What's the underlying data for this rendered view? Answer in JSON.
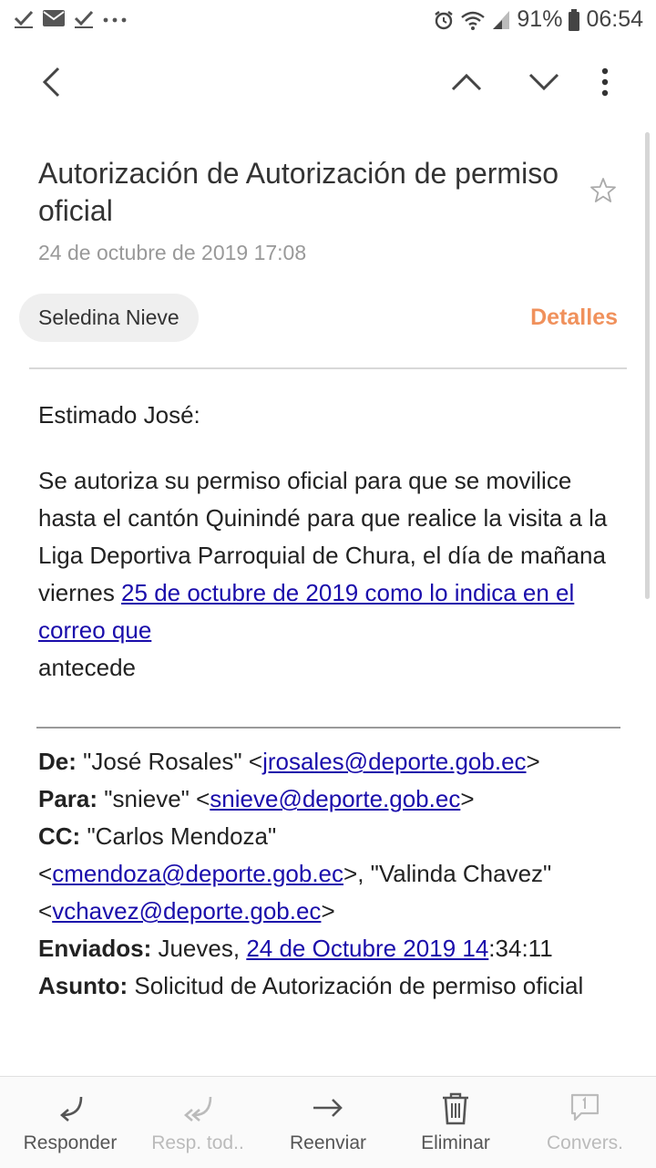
{
  "status_bar": {
    "battery": "91%",
    "time": "06:54",
    "icons": [
      "check-icon",
      "mail-icon",
      "check-icon",
      "more-icon",
      "alarm-icon",
      "wifi-icon",
      "signal-icon",
      "battery-icon"
    ]
  },
  "toolbar": {
    "back_icon": "chevron-left-icon",
    "prev_icon": "chevron-up-icon",
    "next_icon": "chevron-down-icon",
    "menu_icon": "more-vertical-icon"
  },
  "email": {
    "subject": "Autorización de Autorización de permiso oficial",
    "date": "24 de octubre de 2019  17:08",
    "sender": "Seledina Nieve",
    "details_label": "Detalles",
    "greeting": "Estimado José:",
    "body_text": "Se autoriza su permiso oficial para que se movilice hasta el cantón Quinindé para que realice la visita a la Liga Deportiva Parroquial de Chura, el día de mañana viernes ",
    "body_link": "25 de octubre de 2019 como lo indica en el correo que",
    "body_tail": "antecede"
  },
  "quoted": {
    "from_label": "De:",
    "from_name": " \"José Rosales\" <",
    "from_email": "jrosales@deporte.gob.ec",
    "to_label": "Para:",
    "to_name": " \"snieve\" <",
    "to_email": "snieve@deporte.gob.ec",
    "cc_label": "CC:",
    "cc_name1": " \"Carlos Mendoza\"",
    "cc_email1": "cmendoza@deporte.gob.ec",
    "cc_mid": ">, \"Valinda Chavez\"",
    "cc_email2": "vchavez@deporte.gob.ec",
    "sent_label": "Enviados:",
    "sent_prefix": " Jueves, ",
    "sent_link": "24 de Octubre 2019 14",
    "sent_suffix": ":34:11",
    "subject_label": "Asunto:",
    "subject_value": " Solicitud de Autorización de permiso oficial"
  },
  "actions": [
    {
      "label": "Responder",
      "icon": "reply-icon",
      "enabled": true
    },
    {
      "label": "Resp. tod..",
      "icon": "reply-all-icon",
      "enabled": false
    },
    {
      "label": "Reenviar",
      "icon": "forward-icon",
      "enabled": true
    },
    {
      "label": "Eliminar",
      "icon": "trash-icon",
      "enabled": true
    },
    {
      "label": "Convers.",
      "icon": "conversation-icon",
      "enabled": false
    }
  ],
  "colors": {
    "accent": "#f0915c",
    "link": "#1a0dab"
  }
}
